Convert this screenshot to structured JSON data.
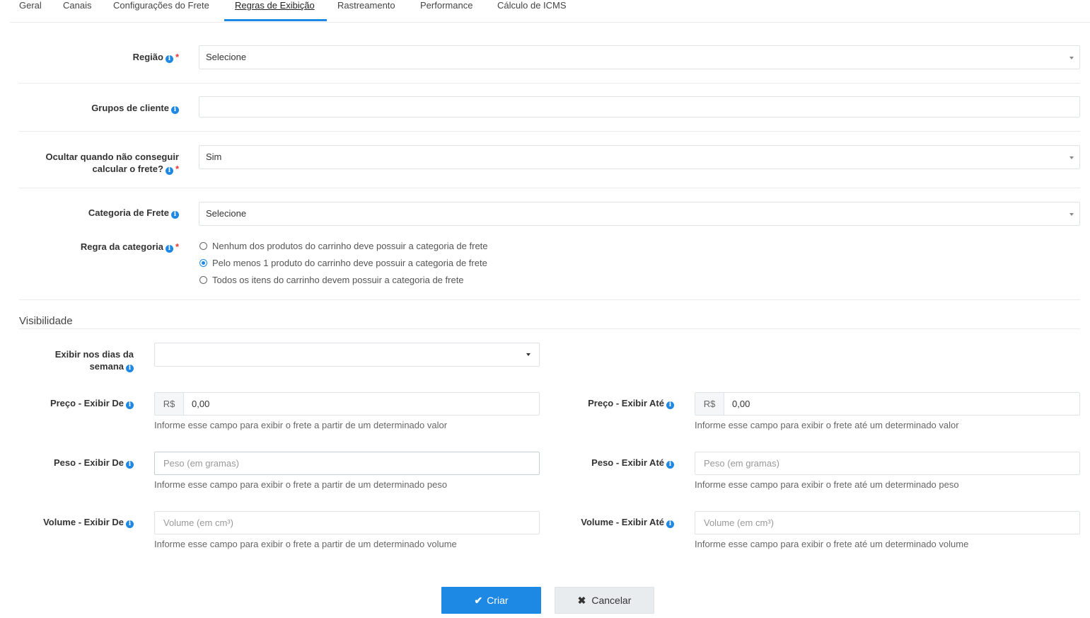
{
  "tabs": [
    {
      "label": "Geral"
    },
    {
      "label": "Canais"
    },
    {
      "label": "Configurações do Frete"
    },
    {
      "label": "Regras de Exibição"
    },
    {
      "label": "Rastreamento"
    },
    {
      "label": "Performance"
    },
    {
      "label": "Cálculo de ICMS"
    }
  ],
  "active_tab": "Regras de Exibição",
  "form": {
    "regiao": {
      "label": "Região",
      "value": "Selecione",
      "required": "*"
    },
    "grupos": {
      "label": "Grupos de cliente",
      "value": ""
    },
    "ocultar": {
      "label_line1": "Ocultar quando não conseguir",
      "label_line2": "calcular o frete?",
      "value": "Sim",
      "required": "*"
    },
    "categoria": {
      "label": "Categoria de Frete",
      "value": "Selecione"
    },
    "regra": {
      "label": "Regra da categoria",
      "required": "*",
      "options": [
        "Nenhum dos produtos do carrinho deve possuir a categoria de frete",
        "Pelo menos 1 produto do carrinho deve possuir a categoria de frete",
        "Todos os itens do carrinho devem possuir a categoria de frete"
      ],
      "selected_index": 1
    }
  },
  "visibilidade": {
    "title": "Visibilidade",
    "dias": {
      "label_line1": "Exibir nos dias da",
      "label_line2": "semana",
      "value": ""
    },
    "preco_de": {
      "label": "Preço - Exibir De",
      "prefix": "R$",
      "value": "0,00",
      "hint": "Informe esse campo para exibir o frete a partir de um determinado valor"
    },
    "preco_ate": {
      "label": "Preço - Exibir Até",
      "prefix": "R$",
      "value": "0,00",
      "hint": "Informe esse campo para exibir o frete até um determinado valor"
    },
    "peso_de": {
      "label": "Peso - Exibir De",
      "placeholder": "Peso (em gramas)",
      "hint": "Informe esse campo para exibir o frete a partir de um determinado peso"
    },
    "peso_ate": {
      "label": "Peso - Exibir Até",
      "placeholder": "Peso (em gramas)",
      "hint": "Informe esse campo para exibir o frete até um determinado peso"
    },
    "volume_de": {
      "label": "Volume - Exibir De",
      "placeholder": "Volume (em cm³)",
      "hint": "Informe esse campo para exibir o frete a partir de um determinado volume"
    },
    "volume_ate": {
      "label": "Volume - Exibir Até",
      "placeholder": "Volume (em cm³)",
      "hint": "Informe esse campo para exibir o frete até um determinado volume"
    }
  },
  "buttons": {
    "criar": "Criar",
    "cancelar": "Cancelar"
  },
  "colors": {
    "accent": "#1e88e5",
    "required": "#e53935"
  }
}
